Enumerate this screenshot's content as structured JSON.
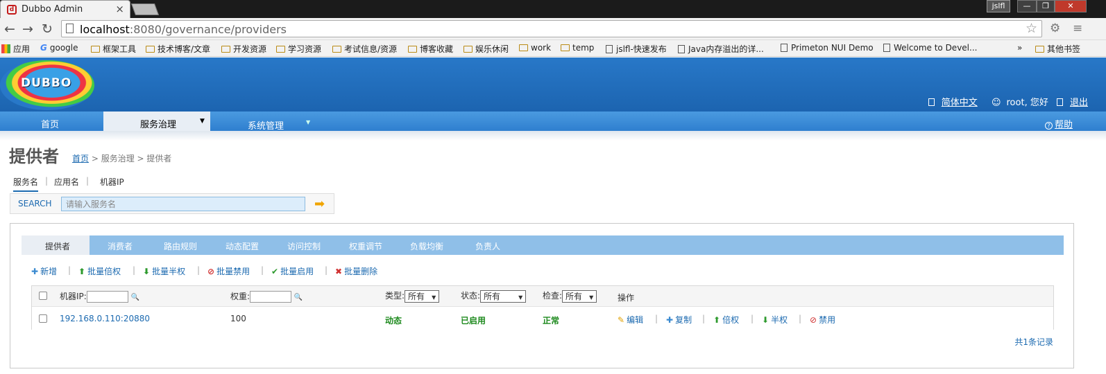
{
  "browser": {
    "tab_title": "Dubbo Admin",
    "tab_close": "×",
    "profile": "jslfl",
    "url_host": "localhost",
    "url_path": ":8080/governance/providers",
    "win_min": "—",
    "win_max": "❐",
    "win_close": "✕",
    "back": "←",
    "forward": "→",
    "reload": "↻",
    "star": "☆",
    "menu": "≡",
    "bookmarks": [
      {
        "label": "应用",
        "kind": "apps"
      },
      {
        "label": "google",
        "kind": "google"
      },
      {
        "label": "框架工具",
        "kind": "folder"
      },
      {
        "label": "技术博客/文章",
        "kind": "folder"
      },
      {
        "label": "开发资源",
        "kind": "folder"
      },
      {
        "label": "学习资源",
        "kind": "folder"
      },
      {
        "label": "考试信息/资源",
        "kind": "folder"
      },
      {
        "label": "博客收藏",
        "kind": "folder"
      },
      {
        "label": "娱乐休闲",
        "kind": "folder"
      },
      {
        "label": "work",
        "kind": "folder"
      },
      {
        "label": "temp",
        "kind": "folder"
      },
      {
        "label": "jslfl-快速发布",
        "kind": "doc"
      },
      {
        "label": "Java内存溢出的详...",
        "kind": "doc"
      },
      {
        "label": "Primeton NUI Demo",
        "kind": "doc"
      },
      {
        "label": "Welcome to Devel...",
        "kind": "doc"
      },
      {
        "label": "»",
        "kind": "more"
      },
      {
        "label": "其他书签",
        "kind": "folder"
      }
    ]
  },
  "header": {
    "logo_text": "DUBBO",
    "lang": "简体中文",
    "user": "root, 您好",
    "logout": "退出"
  },
  "nav": {
    "home": "首页",
    "governance": "服务治理",
    "system": "系统管理",
    "help": "帮助",
    "caret": "▼"
  },
  "page": {
    "title": "提供者",
    "breadcrumb_home": "首页",
    "breadcrumb_rest": " > 服务治理 > 提供者"
  },
  "search": {
    "tabs": [
      "服务名",
      "应用名",
      "机器IP"
    ],
    "label": "SEARCH",
    "placeholder": "请输入服务名",
    "go": "➡"
  },
  "panel_tabs": [
    "提供者",
    "消费者",
    "路由规则",
    "动态配置",
    "访问控制",
    "权重调节",
    "负载均衡",
    "负责人"
  ],
  "actions": [
    {
      "icon": "✚",
      "label": "新增",
      "color": "#3a8ad0"
    },
    {
      "icon": "⬆",
      "label": "批量倍权",
      "color": "#2e9a2e"
    },
    {
      "icon": "⬇",
      "label": "批量半权",
      "color": "#2e9a2e"
    },
    {
      "icon": "⊘",
      "label": "批量禁用",
      "color": "#d03030"
    },
    {
      "icon": "✔",
      "label": "批量启用",
      "color": "#2e9a2e"
    },
    {
      "icon": "✖",
      "label": "批量删除",
      "color": "#d03030"
    }
  ],
  "table": {
    "headers": {
      "ip": "机器IP:",
      "weight": "权重:",
      "type": "类型:",
      "type_value": "所有",
      "status": "状态:",
      "status_value": "所有",
      "check": "检查:",
      "check_value": "所有",
      "ops": "操作"
    },
    "row": {
      "address": "192.168.0.110:20880",
      "weight": "100",
      "type": "动态",
      "status": "已启用",
      "check": "正常",
      "ops": [
        {
          "icon": "✎",
          "label": "编辑",
          "color": "#e0a000"
        },
        {
          "icon": "✚",
          "label": "复制",
          "color": "#3a8ad0"
        },
        {
          "icon": "⬆",
          "label": "倍权",
          "color": "#2e9a2e"
        },
        {
          "icon": "⬇",
          "label": "半权",
          "color": "#2e9a2e"
        },
        {
          "icon": "⊘",
          "label": "禁用",
          "color": "#d03030"
        }
      ]
    }
  },
  "total": "共1条记录",
  "magnifier": "🔍"
}
